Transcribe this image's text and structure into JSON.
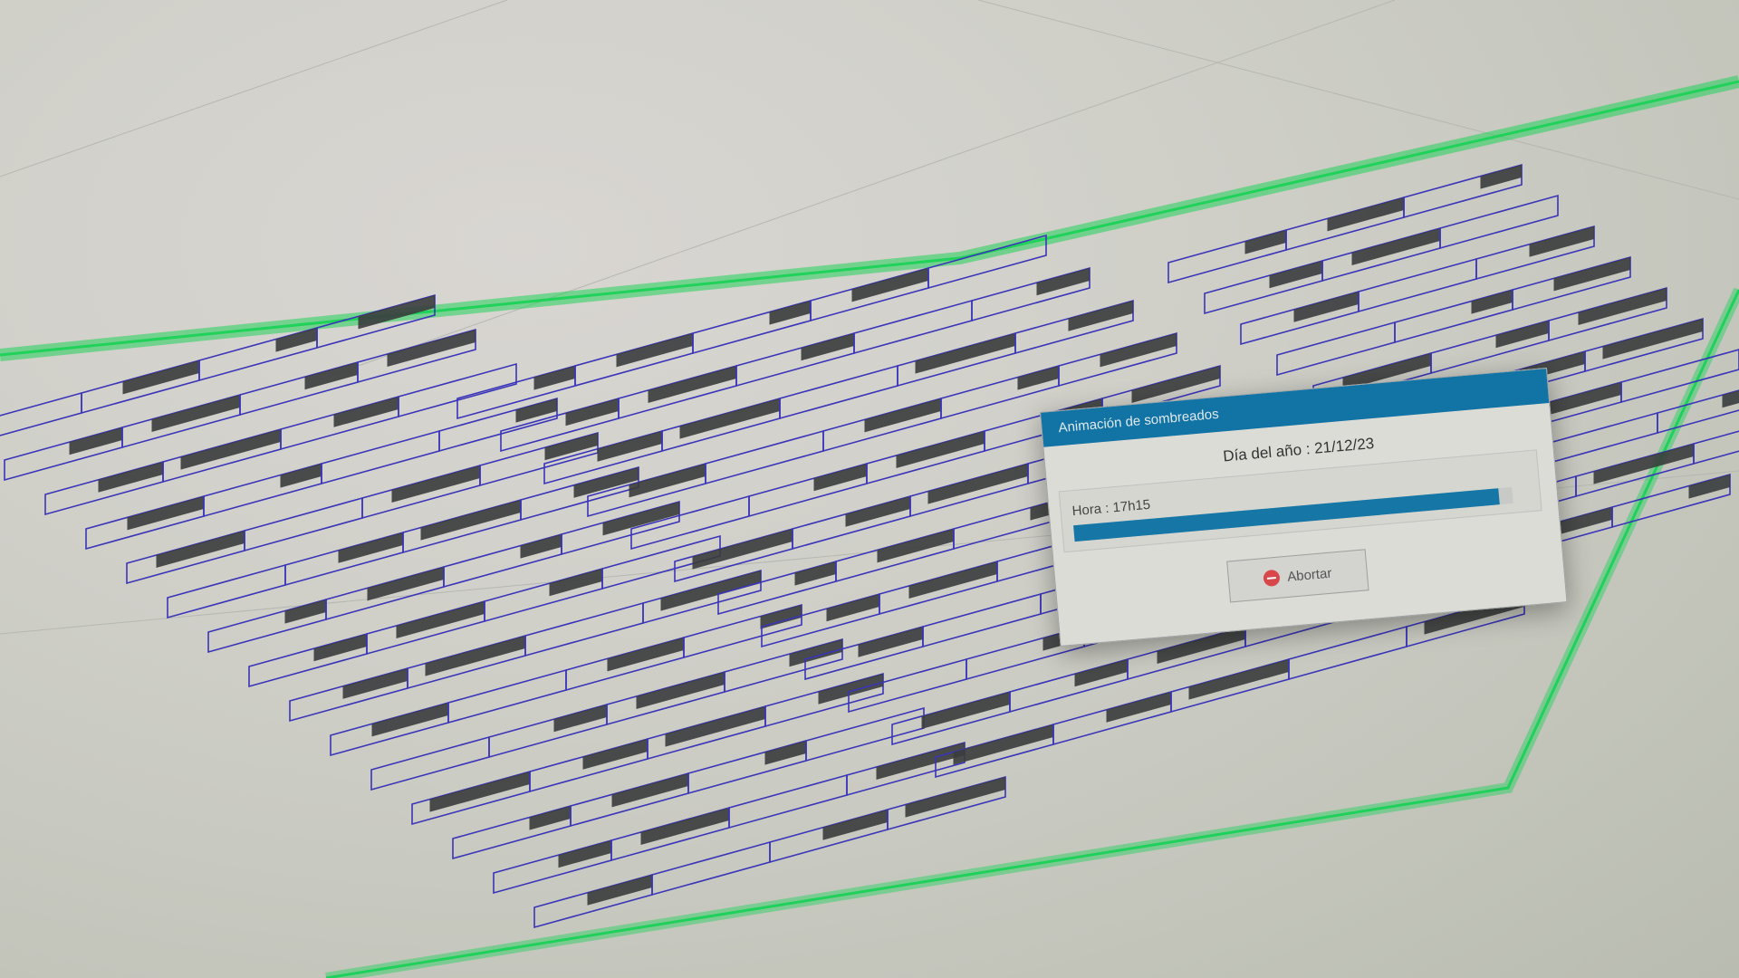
{
  "dialog": {
    "title": "Animación de sombreados",
    "date_line": "Día del año : 21/12/23",
    "hour_line": "Hora : 17h15",
    "progress": 0.97,
    "abort_label": "Abortar",
    "abort_icon": "stop-icon"
  },
  "colors": {
    "boundary": "#20d15a",
    "row_outline": "#3a35b8",
    "shadow": "#3a3c3d",
    "dialog_header": "#1273a5",
    "progress": "#1677a6"
  }
}
